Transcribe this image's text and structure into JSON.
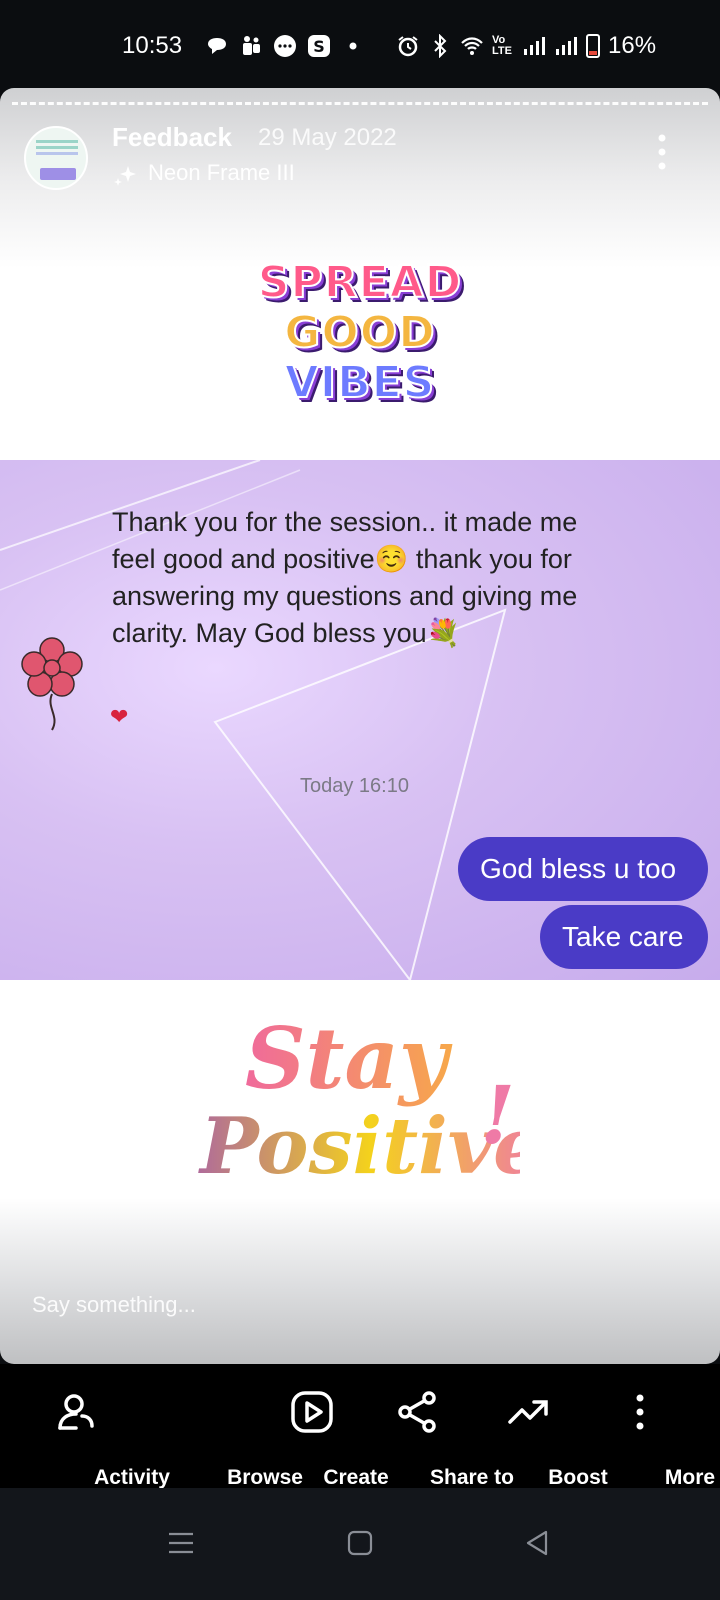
{
  "status_bar": {
    "time": "10:53",
    "left_icons": [
      "chat-bubble-icon",
      "teams-icon",
      "messages-icon",
      "skype-icon",
      "dot-icon"
    ],
    "right_icons": [
      "alarm-icon",
      "bluetooth-icon",
      "wifi-icon",
      "volte-icon",
      "signal-icon",
      "signal-icon"
    ],
    "volte": "Vo LTE",
    "battery": "16%"
  },
  "story": {
    "name": "Feedback",
    "date": "29 May 2022",
    "filter": "Neon Frame III",
    "sticker_top": [
      "SPREAD",
      "GOOD",
      "VIBES"
    ],
    "chat": {
      "message": "Thank you for the session.. it made me feel good and positive☺️ thank you for answering my questions and giving me clarity. May God bless you💐",
      "heart": "❤",
      "time": "Today 16:10",
      "reply_1": "God bless u too",
      "reply_2": "Take care"
    },
    "sticker_bottom": [
      "Stay",
      "Positive",
      "!"
    ],
    "reply_placeholder": "Say something..."
  },
  "bottom_nav": {
    "items": [
      {
        "label": "Activity",
        "icon": "activity-icon"
      },
      {
        "label": "Browse",
        "icon": "browse-icon"
      },
      {
        "label": "Create",
        "icon": "create-icon"
      },
      {
        "label": "Share to",
        "icon": "share-icon"
      },
      {
        "label": "Boost",
        "icon": "boost-icon"
      },
      {
        "label": "More",
        "icon": "more-vertical-icon"
      }
    ]
  },
  "colors": {
    "bubble": "#4a3bc6",
    "chat_bg": "#d8c1f3",
    "nav_bg": "#000000"
  }
}
